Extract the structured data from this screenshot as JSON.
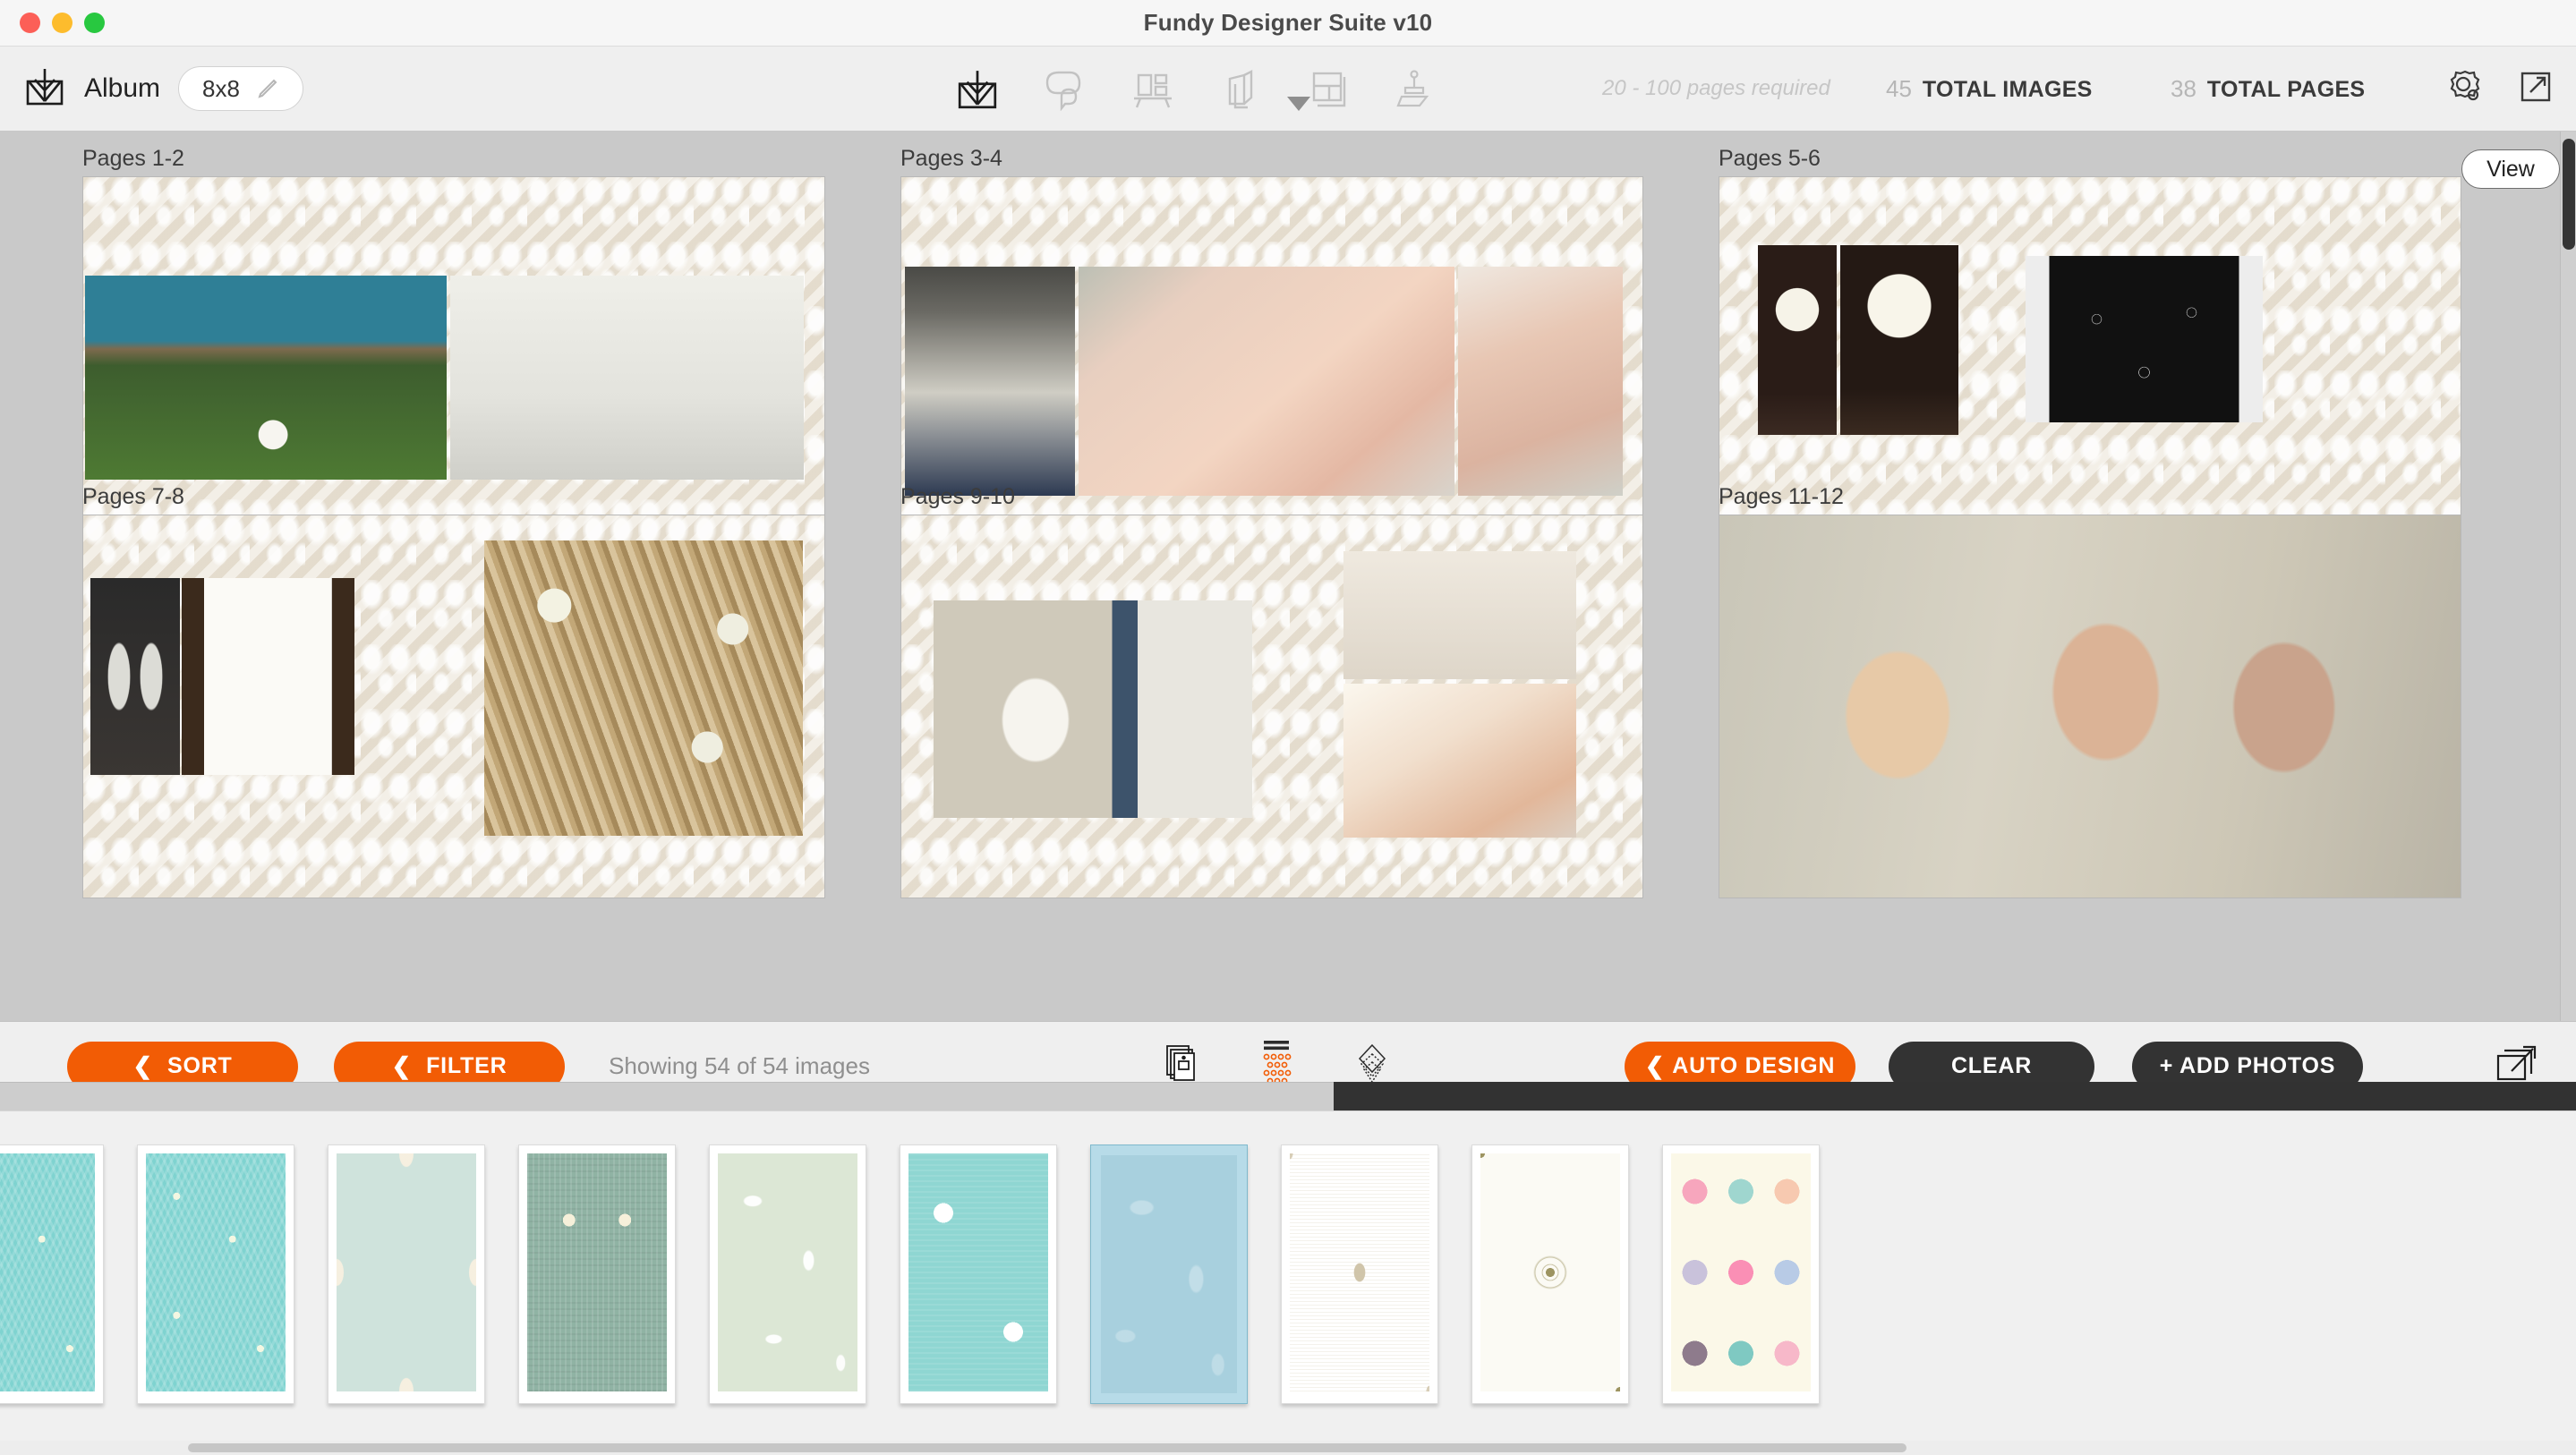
{
  "window": {
    "title": "Fundy Designer Suite v10",
    "traffic_lights": [
      "close",
      "minimize",
      "zoom"
    ]
  },
  "header": {
    "album_label": "Album",
    "size_value": "8x8",
    "edit_icon": "pencil-icon",
    "tools": [
      {
        "name": "album-icon",
        "active": true
      },
      {
        "name": "speech-bubble-icon",
        "active": false
      },
      {
        "name": "wall-art-icon",
        "active": false
      },
      {
        "name": "book-cover-icon",
        "active": false
      },
      {
        "name": "layout-grid-icon",
        "active": false
      },
      {
        "name": "press-stamp-icon",
        "active": false
      }
    ],
    "pages_required": "20 - 100 pages required",
    "total_images_count": "45",
    "total_images_label": "TOTAL IMAGES",
    "total_pages_count": "38",
    "total_pages_label": "TOTAL PAGES",
    "right_icons": [
      "design-options-icon",
      "export-icon"
    ]
  },
  "canvas": {
    "view_button": "View",
    "spreads": [
      {
        "label": "Pages 1-2",
        "layout": "two-up"
      },
      {
        "label": "Pages 3-4",
        "layout": "three-up"
      },
      {
        "label": "Pages 5-6",
        "layout": "triptych-plus"
      },
      {
        "label": "Pages 7-8",
        "layout": "two-plus-one"
      },
      {
        "label": "Pages 9-10",
        "layout": "one-plus-two"
      },
      {
        "label": "Pages 11-12",
        "layout": "full-bleed"
      }
    ]
  },
  "footer": {
    "sort_label": "SORT",
    "filter_label": "FILTER",
    "showing_text": "Showing 54 of 54 images",
    "mid_icons": [
      "photo-stack-icon",
      "dot-grid-icon",
      "layers-diamond-icon"
    ],
    "auto_design_label": "AUTO DESIGN",
    "clear_label": "CLEAR",
    "add_photos_label": "+ ADD PHOTOS",
    "share_icon": "share-photo-icon",
    "chevron": "❮"
  },
  "tray": {
    "swatches": [
      {
        "name": "snowflake-teal",
        "pattern": "pat-snowflake",
        "selected": false
      },
      {
        "name": "snowflake-teal-2",
        "pattern": "pat-snowflake",
        "selected": false
      },
      {
        "name": "ogee-mint",
        "pattern": "pat-ogee",
        "selected": false
      },
      {
        "name": "hearts-sage",
        "pattern": "pat-hearts",
        "selected": false
      },
      {
        "name": "scroll-green",
        "pattern": "pat-scroll-green",
        "selected": false
      },
      {
        "name": "polka-dot-aqua",
        "pattern": "pat-dots",
        "selected": false
      },
      {
        "name": "blue-damask",
        "pattern": "pat-blue-damask",
        "selected": true
      },
      {
        "name": "ikat-tan",
        "pattern": "pat-ikat-tan",
        "selected": false
      },
      {
        "name": "medallion-olive",
        "pattern": "pat-medallion",
        "selected": false
      },
      {
        "name": "confetti-pastel",
        "pattern": "pat-confetti",
        "selected": false
      }
    ]
  },
  "colors": {
    "accent_orange": "#f25c05",
    "dark_button": "#333333",
    "canvas_gray": "#c9c9c9",
    "chrome_gray": "#efefef"
  }
}
